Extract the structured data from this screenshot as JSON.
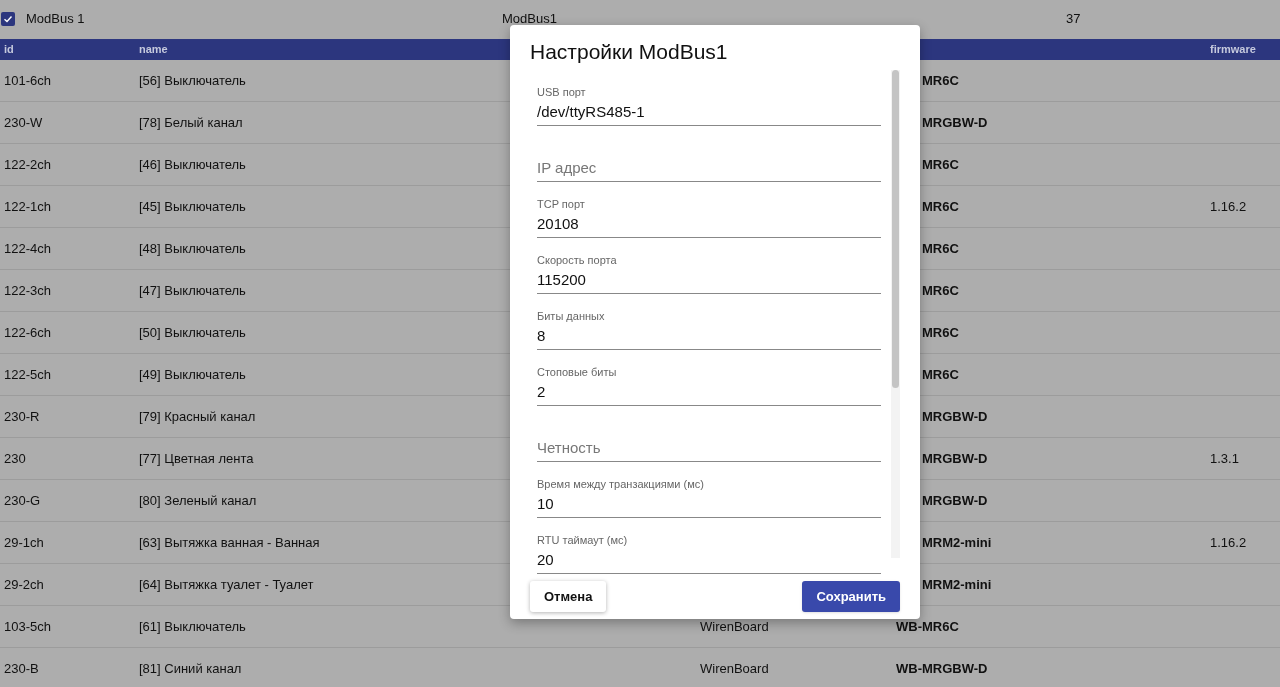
{
  "bus": {
    "checked": true,
    "label": "ModBus 1",
    "name": "ModBus1",
    "count": "37"
  },
  "table": {
    "columns": [
      "id",
      "name",
      "firmware"
    ],
    "rows": [
      {
        "id": "101-6ch",
        "name": "[56] Выключатель",
        "column_5": "MR6C"
      },
      {
        "id": "230-W",
        "name": "[78] Белый канал",
        "column_5": "MRGBW-D"
      },
      {
        "id": "122-2ch",
        "name": "[46] Выключатель",
        "column_5": "MR6C"
      },
      {
        "id": "122-1ch",
        "name": "[45] Выключатель",
        "column_5": "MR6C",
        "firmware": "1.16.2"
      },
      {
        "id": "122-4ch",
        "name": "[48] Выключатель",
        "column_5": "MR6C"
      },
      {
        "id": "122-3ch",
        "name": "[47] Выключатель",
        "column_5": "MR6C"
      },
      {
        "id": "122-6ch",
        "name": "[50] Выключатель",
        "column_5": "MR6C"
      },
      {
        "id": "122-5ch",
        "name": "[49] Выключатель",
        "column_5": "MR6C"
      },
      {
        "id": "230-R",
        "name": "[79] Красный канал",
        "column_5": "MRGBW-D"
      },
      {
        "id": "230",
        "name": "[77] Цветная лента",
        "column_5": "MRGBW-D",
        "firmware": "1.3.1"
      },
      {
        "id": "230-G",
        "name": "[80] Зеленый канал",
        "column_5": "MRGBW-D"
      },
      {
        "id": "29-1ch",
        "name": "[63] Вытяжка ванная - Ванная",
        "column_5": "MRM2-mini",
        "firmware": "1.16.2"
      },
      {
        "id": "29-2ch",
        "name": "[64] Вытяжка туалет - Туалет",
        "column_5": "MRM2-mini"
      },
      {
        "id": "103-5ch",
        "name": "[61] Выключатель",
        "column_4": "WirenBoard",
        "column_5": "WB-MR6C"
      },
      {
        "id": "230-B",
        "name": "[81] Синий канал",
        "column_4": "WirenBoard",
        "column_5": "WB-MRGBW-D"
      }
    ]
  },
  "dialog": {
    "title": "Настройки ModBus1",
    "fields": [
      {
        "label": "USB порт",
        "value": "/dev/ttyRS485-1"
      },
      {
        "placeholder": "IP адрес"
      },
      {
        "label": "TCP порт",
        "value": "20108"
      },
      {
        "label": "Скорость порта",
        "value": "115200"
      },
      {
        "label": "Биты данных",
        "value": "8"
      },
      {
        "label": "Стоповые биты",
        "value": "2"
      },
      {
        "placeholder": "Четность"
      },
      {
        "label": "Время между транзакциями (мс)",
        "value": "10"
      },
      {
        "label": "RTU таймаут (мс)",
        "value": "20"
      }
    ],
    "buttons": [
      {
        "label": "Отмена",
        "kind": "secondary"
      },
      {
        "label": "Сохранить",
        "kind": "primary"
      }
    ]
  }
}
